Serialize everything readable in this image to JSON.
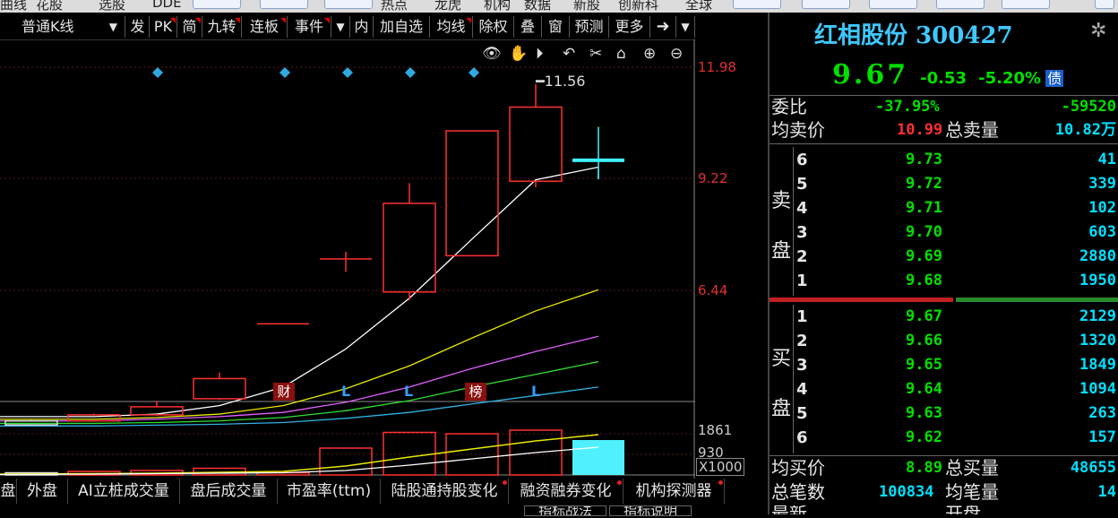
{
  "top_menu": {
    "items": [
      "曲线",
      "花股",
      "选股",
      "DDE",
      "热点",
      "龙虎",
      "机构",
      "数据",
      "新股",
      "创新科",
      "全球"
    ],
    "buttons": [
      "",
      "",
      "",
      "",
      "",
      "",
      "",
      "",
      ""
    ]
  },
  "toolbar": {
    "period_select": "普通K线",
    "items": [
      "发",
      "PK",
      "简",
      "九转",
      "连板",
      "事件",
      "内",
      "加自选",
      "均线",
      "除权",
      "叠",
      "窗",
      "预测",
      "更多"
    ]
  },
  "chart_tools": [
    "eye-icon",
    "hand-icon",
    "play-icon",
    "undo-icon",
    "scissors-icon",
    "lock-icon",
    "zoom-in-icon",
    "zoom-out-icon"
  ],
  "chart_data": {
    "type": "candlestick",
    "price_axis_labels": [
      "11.98",
      "9.22",
      "6.44"
    ],
    "high_annotation": "11.56",
    "volume_axis_labels": [
      "1861",
      "930",
      "X1000"
    ],
    "event_markers": [
      "财",
      "L",
      "L",
      "榜",
      "L"
    ],
    "candles": [
      {
        "open": 3.1,
        "close": 3.2,
        "high": 3.22,
        "low": 3.08,
        "color": "white"
      },
      {
        "open": 3.2,
        "close": 3.35,
        "high": 3.38,
        "low": 3.18,
        "color": "red"
      },
      {
        "open": 3.35,
        "close": 3.55,
        "high": 3.7,
        "low": 3.33,
        "color": "red"
      },
      {
        "open": 3.75,
        "close": 4.25,
        "high": 4.4,
        "low": 3.72,
        "color": "red"
      },
      {
        "open": 5.61,
        "close": 5.61,
        "high": 5.61,
        "low": 5.61,
        "color": "red"
      },
      {
        "open": 7.22,
        "close": 7.22,
        "high": 7.4,
        "low": 6.9,
        "color": "red"
      },
      {
        "open": 6.4,
        "close": 8.6,
        "high": 9.1,
        "low": 6.2,
        "color": "red"
      },
      {
        "open": 7.3,
        "close": 10.4,
        "high": 10.4,
        "low": 7.3,
        "color": "red"
      },
      {
        "open": 9.15,
        "close": 10.99,
        "high": 11.56,
        "low": 9.0,
        "color": "red"
      },
      {
        "open": 9.67,
        "close": 9.67,
        "high": 10.5,
        "low": 9.2,
        "color": "cyan"
      }
    ],
    "volume": [
      0.05,
      0.08,
      0.1,
      0.15,
      0.05,
      0.6,
      0.95,
      0.92,
      1.0,
      0.78
    ]
  },
  "bottom_tabs": [
    "盘",
    "外盘",
    "AI立桩成交量",
    "盘后成交量",
    "市盈率(ttm)",
    "陆股通持股变化",
    "融资融券变化",
    "机构探测器"
  ],
  "bottom_subtabs": [
    "指标战法",
    "指标说明"
  ],
  "stock": {
    "name": "红相股份",
    "code": "300427",
    "price": "9.67",
    "change": "-0.53",
    "change_pct": "-5.20%",
    "badge": "债"
  },
  "stats": {
    "weibi_label": "委比",
    "weibi_pct": "-37.95%",
    "weibi_val": "-59520",
    "avg_sell_label": "均卖价",
    "avg_sell_price": "10.99",
    "total_sell_label": "总卖量",
    "total_sell_qty": "10.82万",
    "avg_buy_label": "均买价",
    "avg_buy_price": "8.89",
    "total_buy_label": "总买量",
    "total_buy_qty": "48655",
    "total_trades_label": "总笔数",
    "total_trades": "100834",
    "avg_trade_label": "均笔量",
    "avg_trade": "14",
    "last_label": "最新",
    "open_label": "开盘"
  },
  "sell_side": {
    "label_top": "卖",
    "label_bottom": "盘",
    "levels": [
      {
        "level": "6",
        "price": "9.73",
        "qty": "41"
      },
      {
        "level": "5",
        "price": "9.72",
        "qty": "339"
      },
      {
        "level": "4",
        "price": "9.71",
        "qty": "102"
      },
      {
        "level": "3",
        "price": "9.70",
        "qty": "603"
      },
      {
        "level": "2",
        "price": "9.69",
        "qty": "2880"
      },
      {
        "level": "1",
        "price": "9.68",
        "qty": "1950"
      }
    ]
  },
  "buy_side": {
    "label_top": "买",
    "label_bottom": "盘",
    "levels": [
      {
        "level": "1",
        "price": "9.67",
        "qty": "2129"
      },
      {
        "level": "2",
        "price": "9.66",
        "qty": "1320"
      },
      {
        "level": "3",
        "price": "9.65",
        "qty": "1849"
      },
      {
        "level": "4",
        "price": "9.64",
        "qty": "1094"
      },
      {
        "level": "5",
        "price": "9.63",
        "qty": "263"
      },
      {
        "level": "6",
        "price": "9.62",
        "qty": "157"
      }
    ]
  }
}
